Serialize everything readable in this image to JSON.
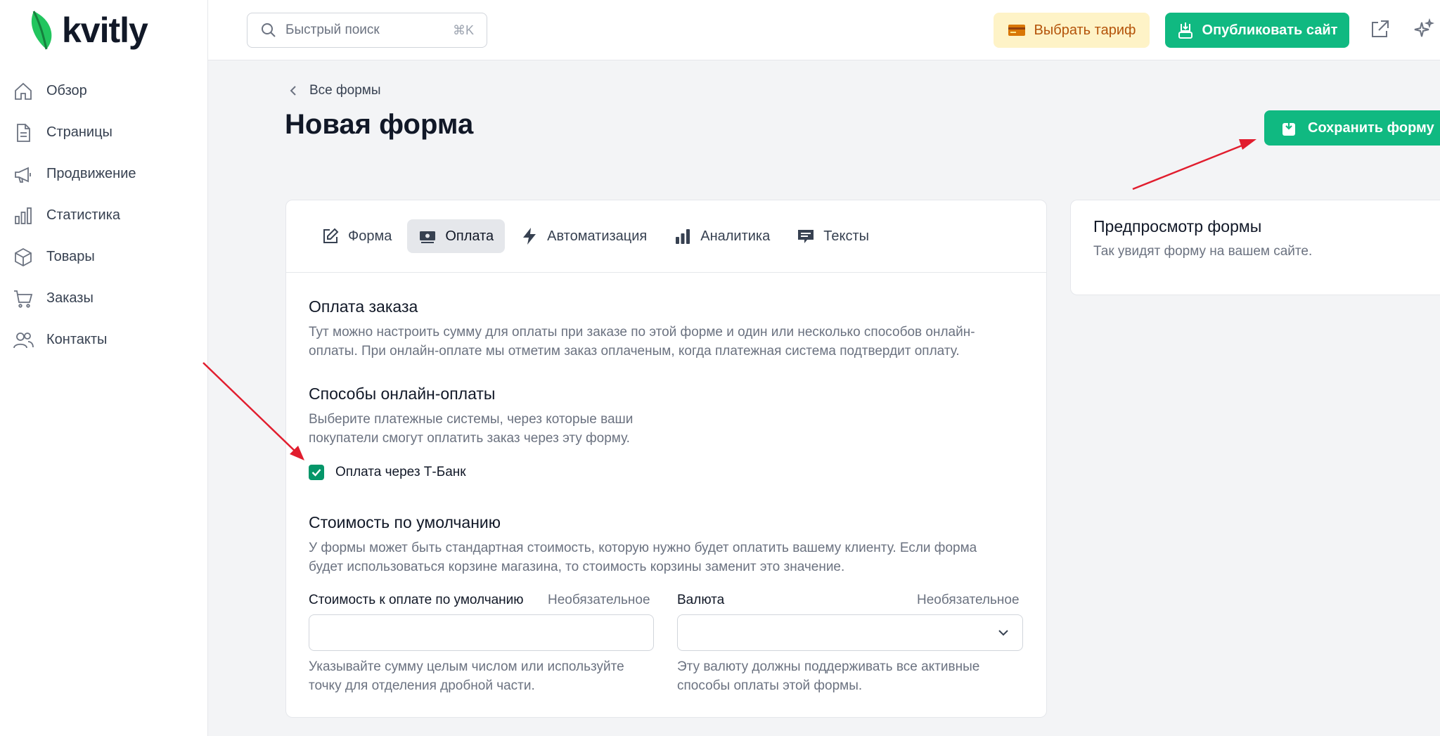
{
  "brand": {
    "name": "kvitly",
    "accent": "#10b981"
  },
  "sidebar": {
    "items": [
      {
        "label": "Обзор",
        "icon": "home-icon"
      },
      {
        "label": "Страницы",
        "icon": "page-icon"
      },
      {
        "label": "Продвижение",
        "icon": "megaphone-icon"
      },
      {
        "label": "Статистика",
        "icon": "bar-chart-icon"
      },
      {
        "label": "Товары",
        "icon": "box-icon"
      },
      {
        "label": "Заказы",
        "icon": "cart-icon"
      },
      {
        "label": "Контакты",
        "icon": "users-icon"
      }
    ]
  },
  "topbar": {
    "search_placeholder": "Быстрый поиск",
    "search_shortcut": "⌘K",
    "tariff_label": "Выбрать тариф",
    "publish_label": "Опубликовать сайт"
  },
  "page": {
    "breadcrumb": "Все формы",
    "title": "Новая форма",
    "save_label": "Сохранить форму"
  },
  "tabs": [
    {
      "label": "Форма",
      "icon": "edit-icon",
      "active": false
    },
    {
      "label": "Оплата",
      "icon": "money-icon",
      "active": true
    },
    {
      "label": "Автоматизация",
      "icon": "lightning-icon",
      "active": false
    },
    {
      "label": "Аналитика",
      "icon": "bar-chart-icon",
      "active": false
    },
    {
      "label": "Тексты",
      "icon": "chat-icon",
      "active": false
    }
  ],
  "payment": {
    "title": "Оплата заказа",
    "desc_line1": "Тут можно настроить сумму для оплаты при заказе по этой форме и один или несколько способов онлайн-",
    "desc_line2": "оплаты. При онлайн-оплате мы отметим заказ оплаченым, когда платежная система подтвердит оплату.",
    "methods_title": "Способы онлайн-оплаты",
    "methods_line1": "Выберите платежные системы, через которые ваши",
    "methods_line2": "покупатели смогут оплатить заказ через эту форму.",
    "tbank_label": "Оплата через Т-Банк",
    "tbank_checked": true,
    "default_title": "Стоимость по умолчанию",
    "default_line1": "У формы может быть стандартная стоимость, которую нужно будет оплатить вашему клиенту. Если форма",
    "default_line2": "будет использоваться корзине магазина, то стоимость корзины заменит это значение.",
    "price_label": "Стоимость к оплате по умолчанию",
    "price_optional": "Необязательное",
    "price_value": "",
    "price_hint_line1": "Указывайте сумму целым числом или используйте",
    "price_hint_line2": "точку для отделения дробной части.",
    "currency_label": "Валюта",
    "currency_optional": "Необязательное",
    "currency_value": "",
    "currency_hint_line1": "Эту валюту должны поддерживать все активные",
    "currency_hint_line2": "способы оплаты этой формы."
  },
  "preview": {
    "title": "Предпросмотр формы",
    "subtitle": "Так увидят форму на вашем сайте."
  },
  "annotation_color": "#e11d2e"
}
